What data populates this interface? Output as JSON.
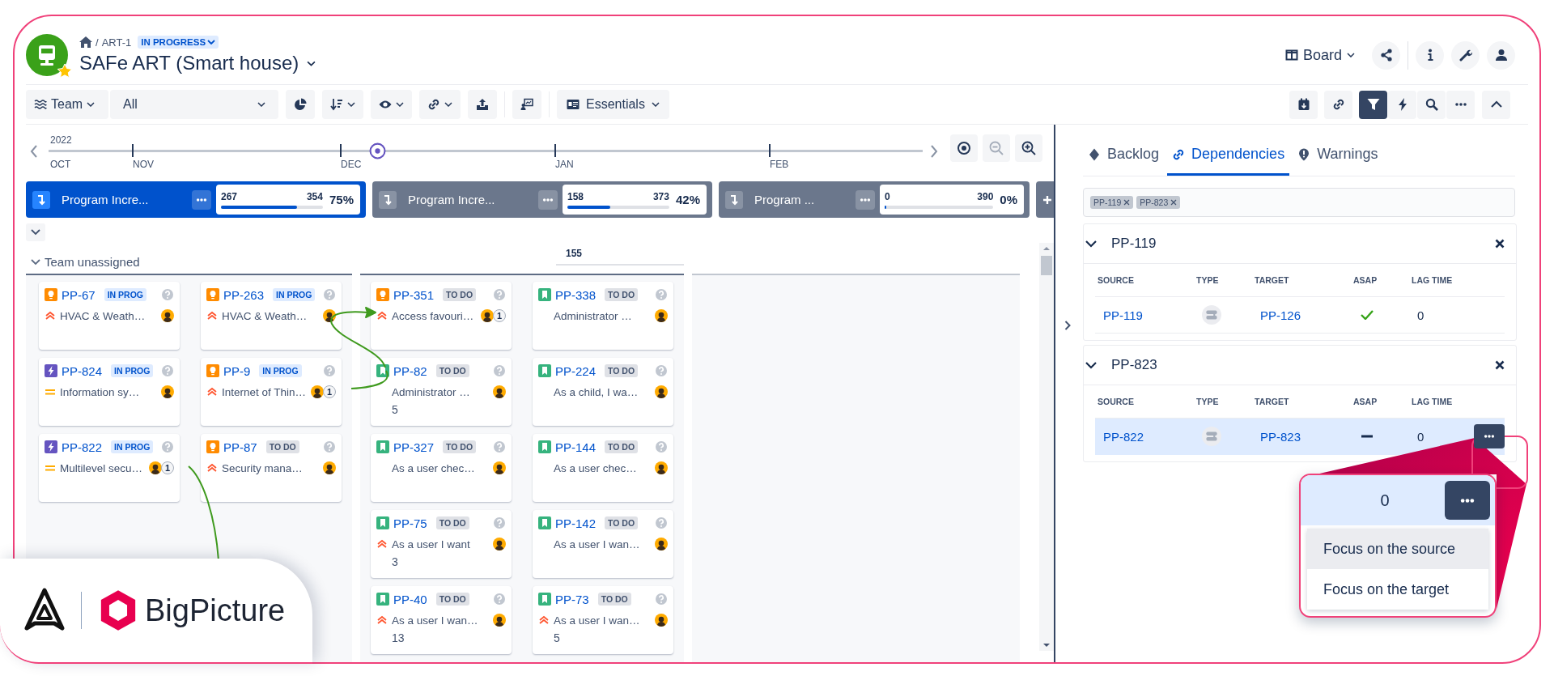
{
  "header": {
    "breadcrumb": {
      "separator": "/",
      "project": "ART-1",
      "status": "IN PROGRESS"
    },
    "title": "SAFe ART (Smart house)",
    "starred": true,
    "view": "Board"
  },
  "toolbar": {
    "group_by": "Team",
    "filter": "All",
    "fields": "Essentials",
    "tools": [
      {
        "kind": "chart",
        "menu": false
      },
      {
        "kind": "sort",
        "menu": true
      },
      {
        "kind": "eye",
        "menu": true
      },
      {
        "kind": "link",
        "menu": true
      },
      {
        "kind": "upload",
        "menu": false
      },
      {
        "kind": "presentation",
        "menu": false
      }
    ],
    "right_tools": [
      {
        "kind": "calendar",
        "selected": false
      },
      {
        "kind": "link",
        "selected": false
      },
      {
        "kind": "filter",
        "selected": true
      },
      {
        "kind": "bolt",
        "selected": false
      },
      {
        "kind": "search",
        "selected": false
      },
      {
        "kind": "more",
        "selected": false
      }
    ]
  },
  "timeline": {
    "year": "2022",
    "months": [
      "OCT",
      "NOV",
      "DEC",
      "JAN",
      "FEB"
    ]
  },
  "increments": [
    {
      "title": "Program Incre...",
      "selected": true,
      "done": "267",
      "total": "354",
      "percent": "75%",
      "level": 0.75
    },
    {
      "title": "Program Incre...",
      "selected": false,
      "done": "158",
      "total": "373",
      "percent": "42%",
      "level": 0.42
    },
    {
      "title": "Program ...",
      "selected": false,
      "done": "0",
      "total": "390",
      "percent": "0%",
      "level": 0
    }
  ],
  "board": {
    "swimlane": "Team unassigned",
    "expanded": true,
    "sprints": [
      {
        "columns": [
          [
            {
              "key": "PP-67",
              "kind": "improvement",
              "status": {
                "label": "IN PROG",
                "kind": "progress"
              },
              "priority": {
                "kind": "high"
              },
              "summary": "HVAC & Weath…"
            },
            {
              "key": "PP-824",
              "kind": "epic",
              "status": {
                "label": "IN PROG",
                "kind": "progress"
              },
              "priority": {
                "kind": "medium"
              },
              "summary": "Information sy…"
            },
            {
              "key": "PP-822",
              "kind": "epic",
              "status": {
                "label": "IN PROG",
                "kind": "progress"
              },
              "priority": {
                "kind": "medium"
              },
              "summary": "Multilevel secu…",
              "links": "1"
            }
          ],
          [
            {
              "key": "PP-263",
              "kind": "improvement",
              "status": {
                "label": "IN PROG",
                "kind": "progress"
              },
              "priority": {
                "kind": "high"
              },
              "summary": "HVAC & Weath…"
            },
            {
              "key": "PP-9",
              "kind": "improvement",
              "status": {
                "label": "IN PROG",
                "kind": "progress"
              },
              "priority": {
                "kind": "high"
              },
              "summary": "Internet of Thin…",
              "links": "1"
            },
            {
              "key": "PP-87",
              "kind": "improvement",
              "status": {
                "label": "TO DO",
                "kind": "todo"
              },
              "priority": {
                "kind": "high"
              },
              "summary": "Security mana…"
            }
          ]
        ]
      },
      {
        "total": "155",
        "columns": [
          [
            {
              "key": "PP-351",
              "kind": "improvement",
              "status": {
                "label": "TO DO",
                "kind": "todo"
              },
              "priority": {
                "kind": "high"
              },
              "summary": "Access favouri…",
              "links": "1"
            },
            {
              "key": "PP-82",
              "kind": "story",
              "status": {
                "label": "TO DO",
                "kind": "todo"
              },
              "summary": "Administrator …",
              "points": "5"
            },
            {
              "key": "PP-327",
              "kind": "story",
              "status": {
                "label": "TO DO",
                "kind": "todo"
              },
              "summary": "As a user chec…"
            },
            {
              "key": "PP-75",
              "kind": "story",
              "status": {
                "label": "TO DO",
                "kind": "todo"
              },
              "priority": {
                "kind": "high"
              },
              "summary": "As a user I want",
              "points": "3"
            },
            {
              "key": "PP-40",
              "kind": "story",
              "status": {
                "label": "TO DO",
                "kind": "todo"
              },
              "priority": {
                "kind": "high"
              },
              "summary": "As a user I wan…",
              "points": "13"
            }
          ],
          [
            {
              "key": "PP-338",
              "kind": "story",
              "status": {
                "label": "TO DO",
                "kind": "todo"
              },
              "summary": "Administrator …"
            },
            {
              "key": "PP-224",
              "kind": "story",
              "status": {
                "label": "TO DO",
                "kind": "todo"
              },
              "summary": "As a child, I wa…"
            },
            {
              "key": "PP-144",
              "kind": "story",
              "status": {
                "label": "TO DO",
                "kind": "todo"
              },
              "summary": "As a user chec…"
            },
            {
              "key": "PP-142",
              "kind": "story",
              "status": {
                "label": "TO DO",
                "kind": "todo"
              },
              "summary": "As a user I wan…"
            },
            {
              "key": "PP-73",
              "kind": "story",
              "status": {
                "label": "TO DO",
                "kind": "todo"
              },
              "priority": {
                "kind": "high"
              },
              "summary": "As a user I wan…",
              "points": "5"
            }
          ]
        ]
      }
    ]
  },
  "panel": {
    "tabs": [
      {
        "label": "Backlog",
        "kind": "backlog",
        "selected": false
      },
      {
        "label": "Dependencies",
        "kind": "dependencies",
        "selected": true
      },
      {
        "label": "Warnings",
        "kind": "warnings",
        "selected": false
      }
    ],
    "chips": [
      "PP-119",
      "PP-823"
    ],
    "groups": [
      {
        "title": "PP-119",
        "expanded": true,
        "columns": [
          "SOURCE",
          "TYPE",
          "TARGET",
          "ASAP",
          "LAG TIME"
        ],
        "rows": [
          {
            "source": "PP-119",
            "target": "PP-126",
            "asap": true,
            "lag": "0",
            "selected": false
          }
        ]
      },
      {
        "title": "PP-823",
        "expanded": true,
        "columns": [
          "SOURCE",
          "TYPE",
          "TARGET",
          "ASAP",
          "LAG TIME"
        ],
        "rows": [
          {
            "source": "PP-822",
            "target": "PP-823",
            "asap": false,
            "lag": "0",
            "selected": true
          }
        ]
      }
    ]
  },
  "zoom_popup": {
    "value": "0",
    "items": [
      {
        "label": "Focus on the source",
        "selected": true
      },
      {
        "label": "Focus on the target",
        "selected": false
      }
    ]
  },
  "brand": {
    "name": "BigPicture"
  }
}
